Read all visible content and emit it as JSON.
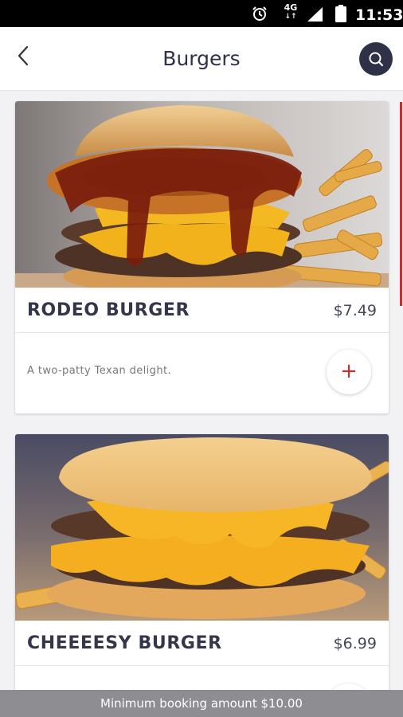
{
  "status_bar": {
    "time": "11:53",
    "network": "4G",
    "icons": [
      "alarm-icon",
      "network-4g-icon",
      "signal-icon",
      "battery-icon"
    ]
  },
  "header": {
    "title": "Burgers",
    "back_icon": "chevron-left-icon",
    "search_icon": "search-icon"
  },
  "products": [
    {
      "name": "RODEO BURGER",
      "price": "$7.49",
      "description": "A two-patty Texan delight.",
      "add_label": "+",
      "image": "burger-photo-onion-ring-bbq"
    },
    {
      "name": "CHEEEESY BURGER",
      "price": "$6.99",
      "description": "",
      "add_label": "+",
      "image": "burger-photo-cheese"
    }
  ],
  "footer": {
    "text": "Minimum booking amount $10.00"
  },
  "colors": {
    "accent": "#d22a2a",
    "header_button": "#2e3147",
    "title_text": "#30324a",
    "footer_bg": "#8d8d92"
  }
}
